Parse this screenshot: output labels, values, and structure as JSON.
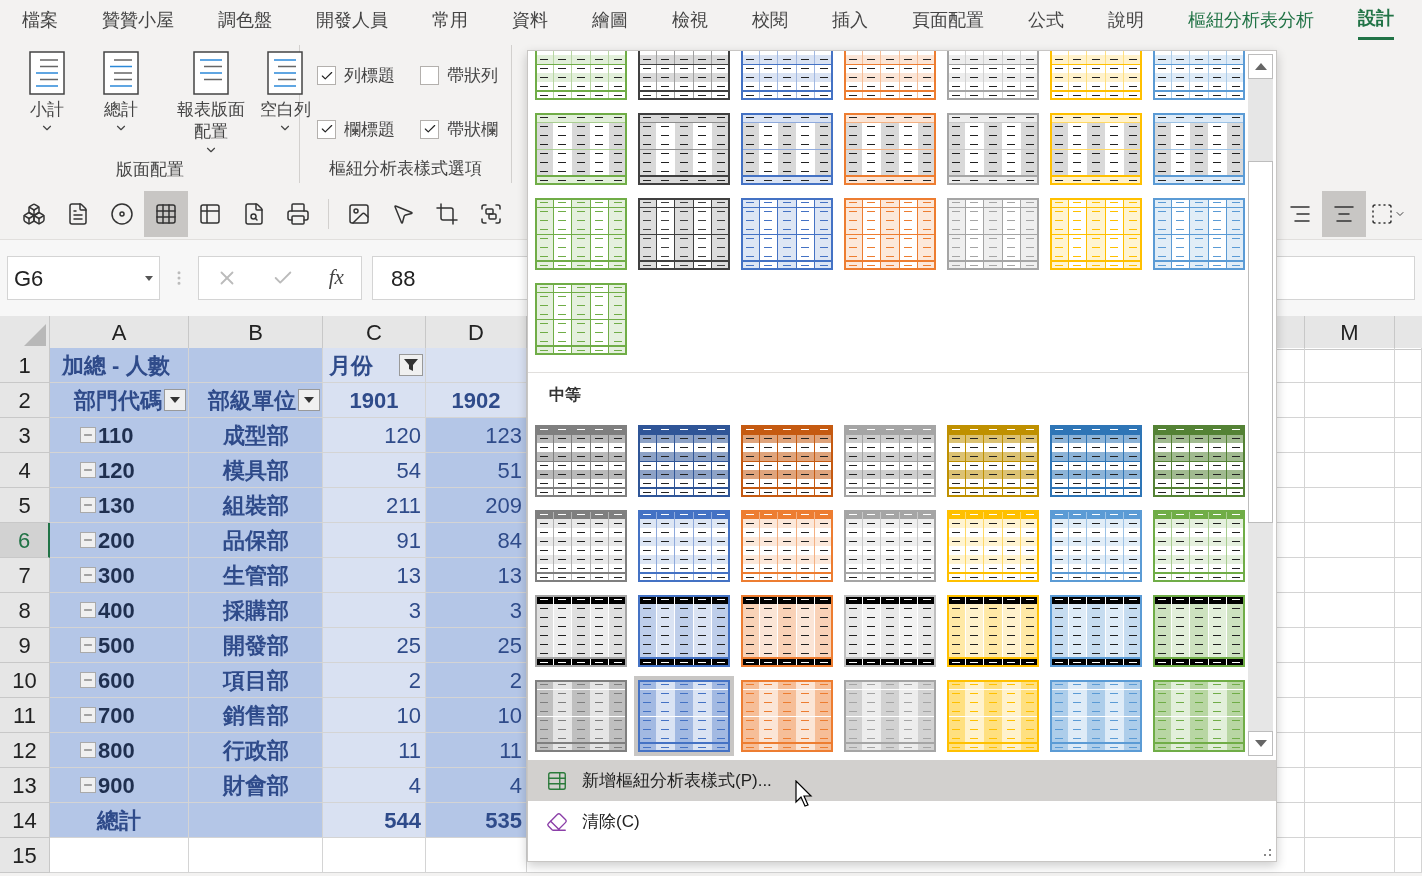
{
  "ribbon_tabs": [
    {
      "label": "檔案",
      "selected": false,
      "contextual": false
    },
    {
      "label": "贊贊小屋",
      "selected": false,
      "contextual": false
    },
    {
      "label": "調色盤",
      "selected": false,
      "contextual": false
    },
    {
      "label": "開發人員",
      "selected": false,
      "contextual": false
    },
    {
      "label": "常用",
      "selected": false,
      "contextual": false
    },
    {
      "label": "資料",
      "selected": false,
      "contextual": false
    },
    {
      "label": "繪圖",
      "selected": false,
      "contextual": false
    },
    {
      "label": "檢視",
      "selected": false,
      "contextual": false
    },
    {
      "label": "校閱",
      "selected": false,
      "contextual": false
    },
    {
      "label": "插入",
      "selected": false,
      "contextual": false
    },
    {
      "label": "頁面配置",
      "selected": false,
      "contextual": false
    },
    {
      "label": "公式",
      "selected": false,
      "contextual": false
    },
    {
      "label": "說明",
      "selected": false,
      "contextual": false
    },
    {
      "label": "樞紐分析表分析",
      "selected": false,
      "contextual": true
    },
    {
      "label": "設計",
      "selected": true,
      "contextual": true
    }
  ],
  "layout_group": {
    "label": "版面配置",
    "buttons": [
      {
        "label": "小計"
      },
      {
        "label": "總計"
      },
      {
        "label": "報表版面配置"
      },
      {
        "label": "空白列"
      }
    ]
  },
  "style_options": {
    "label": "樞紐分析表樣式選項",
    "checkboxes": [
      {
        "label": "列標題",
        "checked": true
      },
      {
        "label": "帶狀列",
        "checked": false
      },
      {
        "label": "欄標題",
        "checked": true
      },
      {
        "label": "帶狀欄",
        "checked": true
      }
    ]
  },
  "toolbar": [
    {
      "kind": "cubes",
      "selected": false
    },
    {
      "kind": "form",
      "selected": false
    },
    {
      "kind": "record",
      "selected": false
    },
    {
      "kind": "grid",
      "selected": true
    },
    {
      "kind": "table",
      "selected": false
    },
    {
      "kind": "preview",
      "selected": false
    },
    {
      "kind": "printer",
      "selected": false
    },
    {
      "kind": "picture",
      "selected": false
    },
    {
      "kind": "pointer",
      "selected": false
    },
    {
      "kind": "crop",
      "selected": false
    },
    {
      "kind": "group",
      "selected": false
    }
  ],
  "align_toolbar": [
    {
      "kind": "align-right",
      "selected": false
    },
    {
      "kind": "align-center",
      "selected": true
    },
    {
      "kind": "borders",
      "selected": false
    }
  ],
  "formula_bar": {
    "name_box": "G6",
    "function_label": "fx",
    "value": "88"
  },
  "sheet": {
    "columns": [
      "A",
      "B",
      "C",
      "D",
      "M"
    ],
    "row_headers": [
      {
        "label": "1",
        "selected": false
      },
      {
        "label": "2",
        "selected": false
      },
      {
        "label": "3",
        "selected": false
      },
      {
        "label": "4",
        "selected": false
      },
      {
        "label": "5",
        "selected": false
      },
      {
        "label": "6",
        "selected": true
      },
      {
        "label": "7",
        "selected": false
      },
      {
        "label": "8",
        "selected": false
      },
      {
        "label": "9",
        "selected": false
      },
      {
        "label": "10",
        "selected": false
      },
      {
        "label": "11",
        "selected": false
      },
      {
        "label": "12",
        "selected": false
      },
      {
        "label": "13",
        "selected": false
      },
      {
        "label": "14",
        "selected": false
      },
      {
        "label": "15",
        "selected": false
      }
    ]
  },
  "pivot": {
    "title": "加總 - 人數",
    "column_field": "月份",
    "row_fields": [
      "部門代碼",
      "部級單位"
    ],
    "months": [
      "1901",
      "1902"
    ],
    "items": [
      {
        "code": "110",
        "name": "成型部",
        "values": [
          "120",
          "123"
        ],
        "expanded": true
      },
      {
        "code": "120",
        "name": "模具部",
        "values": [
          "54",
          "51"
        ],
        "expanded": true
      },
      {
        "code": "130",
        "name": "組裝部",
        "values": [
          "211",
          "209"
        ],
        "expanded": true
      },
      {
        "code": "200",
        "name": "品保部",
        "values": [
          "91",
          "84"
        ],
        "expanded": true
      },
      {
        "code": "300",
        "name": "生管部",
        "values": [
          "13",
          "13"
        ],
        "expanded": true
      },
      {
        "code": "400",
        "name": "採購部",
        "values": [
          "3",
          "3"
        ],
        "expanded": true
      },
      {
        "code": "500",
        "name": "開發部",
        "values": [
          "25",
          "25"
        ],
        "expanded": true
      },
      {
        "code": "600",
        "name": "項目部",
        "values": [
          "2",
          "2"
        ],
        "expanded": true
      },
      {
        "code": "700",
        "name": "銷售部",
        "values": [
          "10",
          "10"
        ],
        "expanded": true
      },
      {
        "code": "800",
        "name": "行政部",
        "values": [
          "11",
          "11"
        ],
        "expanded": true
      },
      {
        "code": "900",
        "name": "財會部",
        "values": [
          "4",
          "4"
        ],
        "expanded": true
      }
    ],
    "total": {
      "label": "總計",
      "values": [
        "544",
        "535"
      ]
    }
  },
  "style_gallery": {
    "sections": [
      {
        "rows": [
          {
            "styles": [
              {
                "kind": "banded-rows",
                "color": "#70ad47",
                "selected": false
              },
              {
                "kind": "banded-rows",
                "color": "#404040",
                "selected": false
              },
              {
                "kind": "banded-rows",
                "color": "#4472c4",
                "selected": false
              },
              {
                "kind": "banded-rows",
                "color": "#ed7d31",
                "selected": false
              },
              {
                "kind": "banded-rows",
                "color": "#a5a5a5",
                "selected": false
              },
              {
                "kind": "banded-rows",
                "color": "#ffc000",
                "selected": false
              },
              {
                "kind": "banded-rows",
                "color": "#5b9bd5",
                "selected": false
              }
            ]
          },
          {
            "styles": [
              {
                "kind": "banded-columns",
                "color": "#70ad47",
                "selected": false
              },
              {
                "kind": "banded-columns",
                "color": "#404040",
                "selected": false
              },
              {
                "kind": "banded-columns",
                "color": "#4472c4",
                "selected": false
              },
              {
                "kind": "banded-columns",
                "color": "#ed7d31",
                "selected": false
              },
              {
                "kind": "banded-columns",
                "color": "#a5a5a5",
                "selected": false
              },
              {
                "kind": "banded-columns",
                "color": "#ffc000",
                "selected": false
              },
              {
                "kind": "banded-columns",
                "color": "#5b9bd5",
                "selected": false
              }
            ]
          },
          {
            "styles": [
              {
                "kind": "bordered",
                "color": "#70ad47",
                "selected": false
              },
              {
                "kind": "bordered",
                "color": "#404040",
                "selected": false
              },
              {
                "kind": "bordered",
                "color": "#4472c4",
                "selected": false
              },
              {
                "kind": "bordered",
                "color": "#ed7d31",
                "selected": false
              },
              {
                "kind": "bordered",
                "color": "#a5a5a5",
                "selected": false
              },
              {
                "kind": "bordered",
                "color": "#ffc000",
                "selected": false
              },
              {
                "kind": "bordered",
                "color": "#5b9bd5",
                "selected": false
              }
            ]
          },
          {
            "styles": [
              {
                "kind": "bordered",
                "color": "#70ad47",
                "selected": false
              }
            ]
          }
        ]
      },
      {
        "heading": "中等",
        "rows": [
          {
            "styles": [
              {
                "kind": "dark-header",
                "color": "#7f7f7f",
                "selected": false
              },
              {
                "kind": "dark-header",
                "color": "#2f5597",
                "selected": false
              },
              {
                "kind": "dark-header",
                "color": "#c55a11",
                "selected": false
              },
              {
                "kind": "dark-header",
                "color": "#a5a5a5",
                "selected": false
              },
              {
                "kind": "dark-header",
                "color": "#bf9000",
                "selected": false
              },
              {
                "kind": "dark-header",
                "color": "#2e75b6",
                "selected": false
              },
              {
                "kind": "dark-header",
                "color": "#548235",
                "selected": false
              }
            ]
          },
          {
            "styles": [
              {
                "kind": "header-tint",
                "color": "#7f7f7f",
                "selected": false
              },
              {
                "kind": "header-tint",
                "color": "#4472c4",
                "selected": false
              },
              {
                "kind": "header-tint",
                "color": "#ed7d31",
                "selected": false
              },
              {
                "kind": "header-tint",
                "color": "#a5a5a5",
                "selected": false
              },
              {
                "kind": "header-tint",
                "color": "#ffc000",
                "selected": false
              },
              {
                "kind": "header-tint",
                "color": "#5b9bd5",
                "selected": false
              },
              {
                "kind": "header-tint",
                "color": "#70ad47",
                "selected": false
              }
            ]
          },
          {
            "styles": [
              {
                "kind": "black-ends",
                "color": "#a5a5a5",
                "selected": false
              },
              {
                "kind": "black-ends",
                "color": "#4472c4",
                "selected": false
              },
              {
                "kind": "black-ends",
                "color": "#ed7d31",
                "selected": false
              },
              {
                "kind": "black-ends",
                "color": "#bfbfbf",
                "selected": false
              },
              {
                "kind": "black-ends",
                "color": "#ffc000",
                "selected": false
              },
              {
                "kind": "black-ends",
                "color": "#5b9bd5",
                "selected": false
              },
              {
                "kind": "black-ends",
                "color": "#70ad47",
                "selected": false
              }
            ]
          },
          {
            "styles": [
              {
                "kind": "striped-columns",
                "color": "#7f7f7f",
                "selected": false
              },
              {
                "kind": "striped-columns",
                "color": "#4472c4",
                "selected": true
              },
              {
                "kind": "striped-columns",
                "color": "#ed7d31",
                "selected": false
              },
              {
                "kind": "striped-columns",
                "color": "#a5a5a5",
                "selected": false
              },
              {
                "kind": "striped-columns",
                "color": "#ffc000",
                "selected": false
              },
              {
                "kind": "striped-columns",
                "color": "#5b9bd5",
                "selected": false
              },
              {
                "kind": "striped-columns",
                "color": "#70ad47",
                "selected": false
              }
            ]
          }
        ]
      }
    ]
  },
  "menu": [
    {
      "kind": "new-style",
      "label": "新增樞紐分析表樣式(P)...",
      "selected": true
    },
    {
      "kind": "clear",
      "label": "清除(C)",
      "selected": false
    }
  ]
}
